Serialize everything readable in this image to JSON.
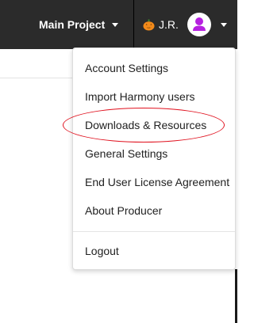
{
  "header": {
    "project_label": "Main Project",
    "user_initials": "J.R."
  },
  "icons": {
    "project_caret": "chevron-down-icon",
    "user_badge": "pumpkin-icon",
    "avatar": "user-avatar-icon",
    "user_caret": "chevron-down-icon"
  },
  "colors": {
    "topbar": "#2b2b2b",
    "avatar_accent": "#b620e0",
    "highlight_ring": "#e0111e"
  },
  "dropdown": {
    "items": [
      "Account Settings",
      "Import Harmony users",
      "Downloads & Resources",
      "General Settings",
      "End User License Agreement",
      "About Producer",
      "Logout"
    ]
  }
}
